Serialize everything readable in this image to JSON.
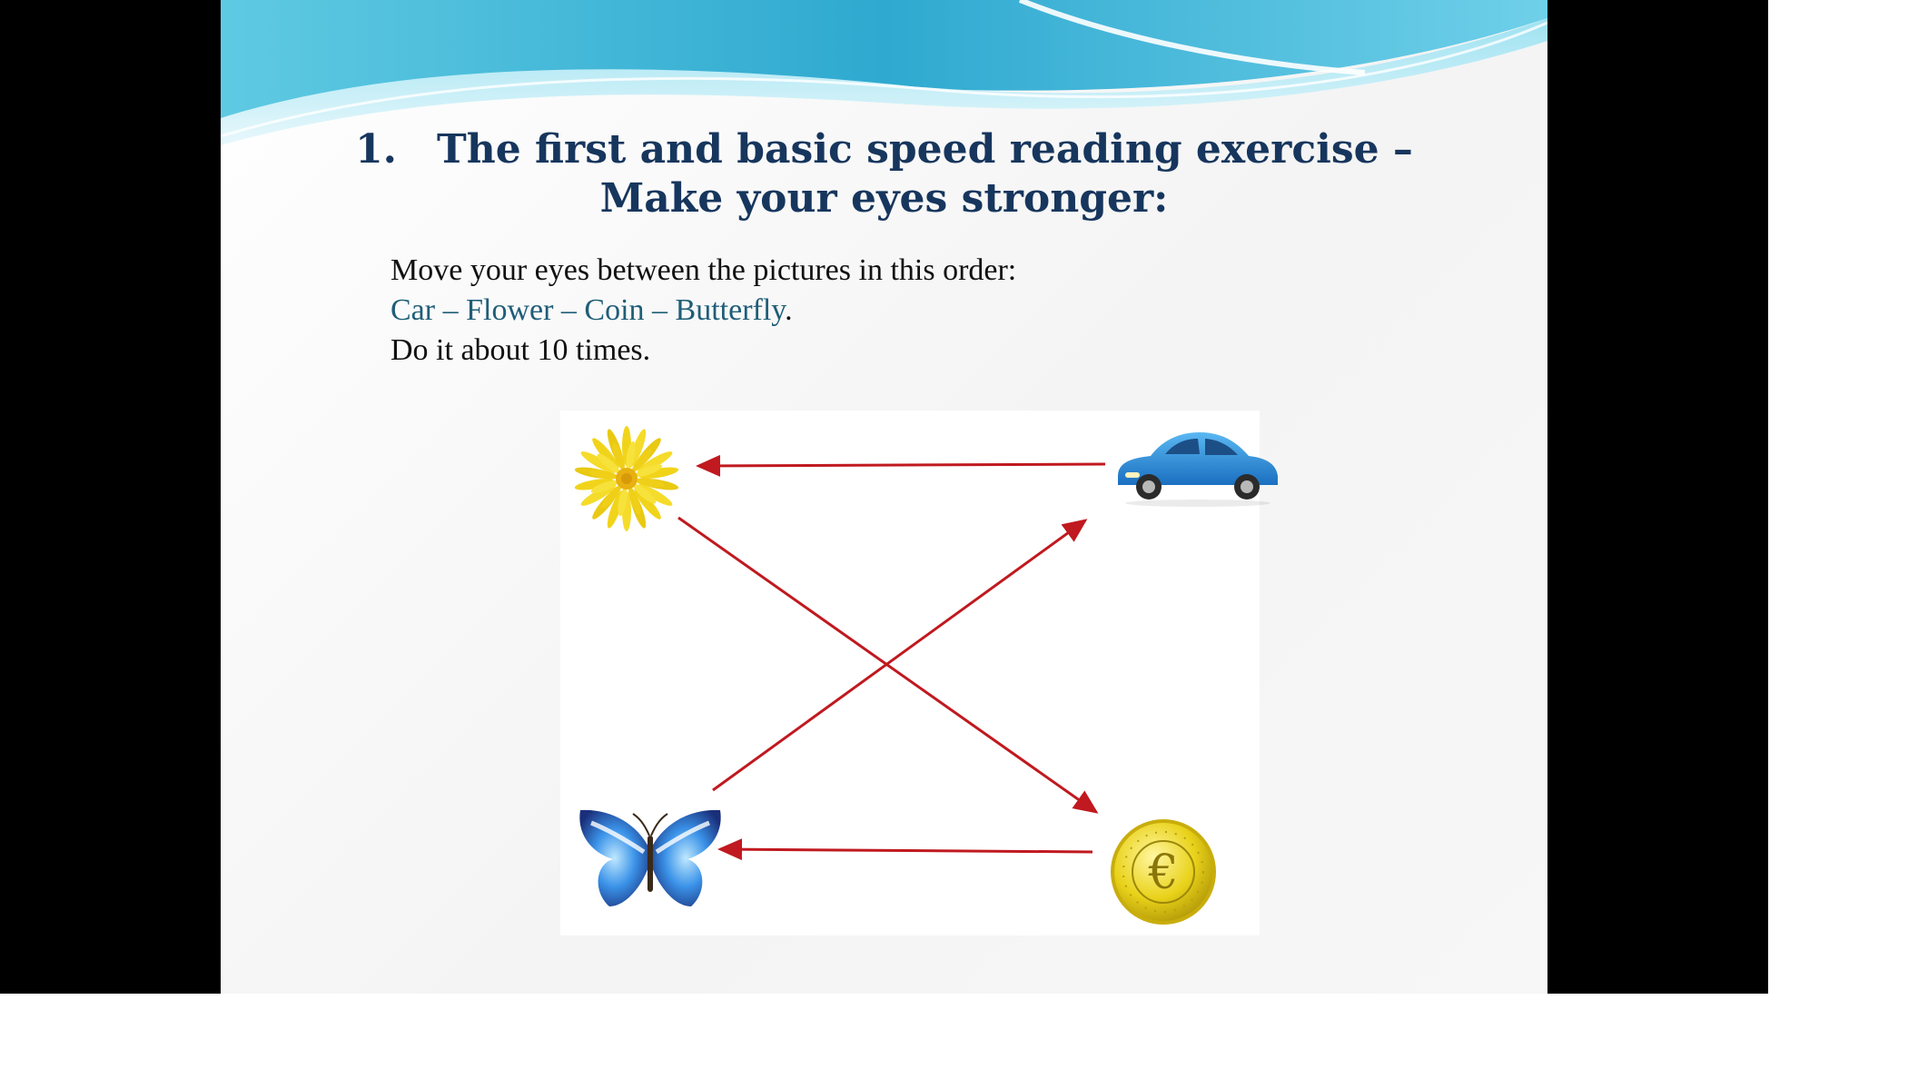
{
  "slide": {
    "title_number": "1.",
    "title_line1": "The first and basic speed reading exercise –",
    "title_line2": "Make your eyes stronger:",
    "instruction": "Move your eyes between the pictures in this order:",
    "order_parts": [
      "Car",
      "Flower",
      "Coin",
      "Butterfly"
    ],
    "order_separator": " – ",
    "order_end": ".",
    "repeat": "Do it about 10 times."
  },
  "diagram": {
    "pictures": [
      "flower-icon",
      "car-icon",
      "butterfly-icon",
      "coin-icon"
    ],
    "arrow_color": "#c0191f",
    "coin_symbol": "€"
  },
  "colors": {
    "title": "#17365d",
    "order_text": "#1f5e78",
    "wave": "#36b6d8"
  }
}
